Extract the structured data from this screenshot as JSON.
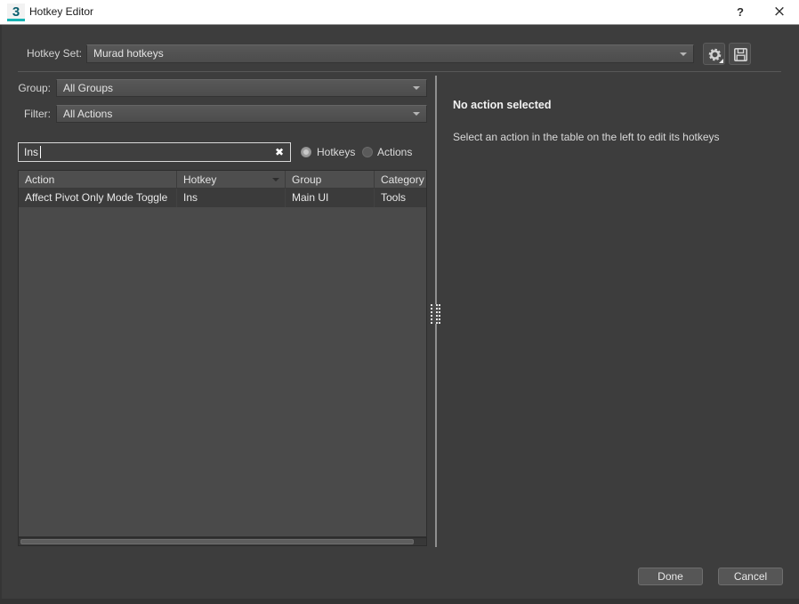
{
  "titlebar": {
    "app_icon": "3",
    "title": "Hotkey Editor",
    "help": "?",
    "close": "×"
  },
  "hotkey_set": {
    "label": "Hotkey Set:",
    "value": "Murad hotkeys"
  },
  "filters": {
    "group_label": "Group:",
    "group_value": "All Groups",
    "filter_label": "Filter:",
    "filter_value": "All Actions"
  },
  "search": {
    "value": "Ins",
    "clear": "✖"
  },
  "radios": {
    "hotkeys_label": "Hotkeys",
    "actions_label": "Actions",
    "selected": "Hotkeys"
  },
  "table": {
    "columns": [
      "Action",
      "Hotkey",
      "Group",
      "Category"
    ],
    "rows": [
      {
        "action": "Affect Pivot Only Mode Toggle",
        "hotkey": "Ins",
        "group": "Main UI",
        "category": "Tools"
      }
    ]
  },
  "detail": {
    "title": "No action selected",
    "message": "Select an action in the table on the left to edit its hotkeys"
  },
  "footer": {
    "done": "Done",
    "cancel": "Cancel"
  },
  "colors": {
    "dialog_bg": "#3d3d3d",
    "table_bg": "#4a4a4a",
    "row_bg": "#3b3b3b",
    "titlebar_bg": "#ffffff",
    "accent_teal": "#18b3b3"
  }
}
